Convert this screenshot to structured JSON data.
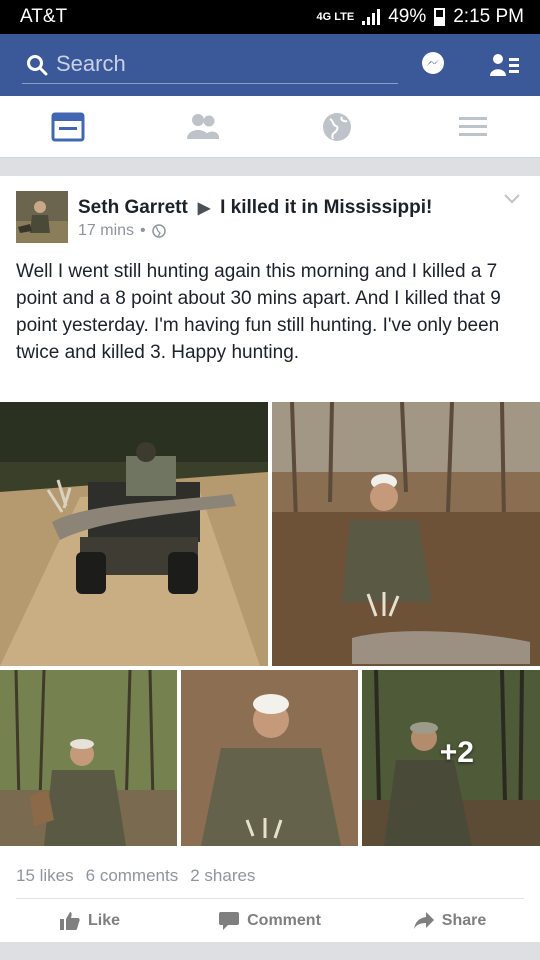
{
  "status_bar": {
    "carrier": "AT&T",
    "network": "4G LTE",
    "battery": "49%",
    "battery_level": 0.49,
    "time": "2:15 PM"
  },
  "search": {
    "placeholder": "Search"
  },
  "nav": {
    "active": "news-feed",
    "tabs": [
      "news-feed",
      "friends",
      "notifications",
      "menu"
    ]
  },
  "post": {
    "author": "Seth Garrett",
    "group": "I killed it in Mississippi!",
    "time": "17 mins",
    "privacy_icon": "globe-icon",
    "text": "Well I went still hunting again this morning and I killed a 7 point and a 8 point about 30 mins apart. And I killed that 9 point yesterday. I'm having fun still hunting.  I've only been twice and killed 3. Happy hunting.",
    "more_photos": "+2",
    "photos": [
      {
        "id": "atv-deer-dirt-road"
      },
      {
        "id": "man-kneeling-with-buck"
      },
      {
        "id": "man-with-deer-in-woods"
      },
      {
        "id": "man-holding-antlers"
      },
      {
        "id": "man-in-cap-woods"
      }
    ]
  },
  "stats": {
    "likes": "15 likes",
    "comments": "6 comments",
    "shares": "2 shares"
  },
  "actions": {
    "like": "Like",
    "comment": "Comment",
    "share": "Share"
  },
  "colors": {
    "brand": "#3b5998",
    "meta_text": "#90949c"
  }
}
